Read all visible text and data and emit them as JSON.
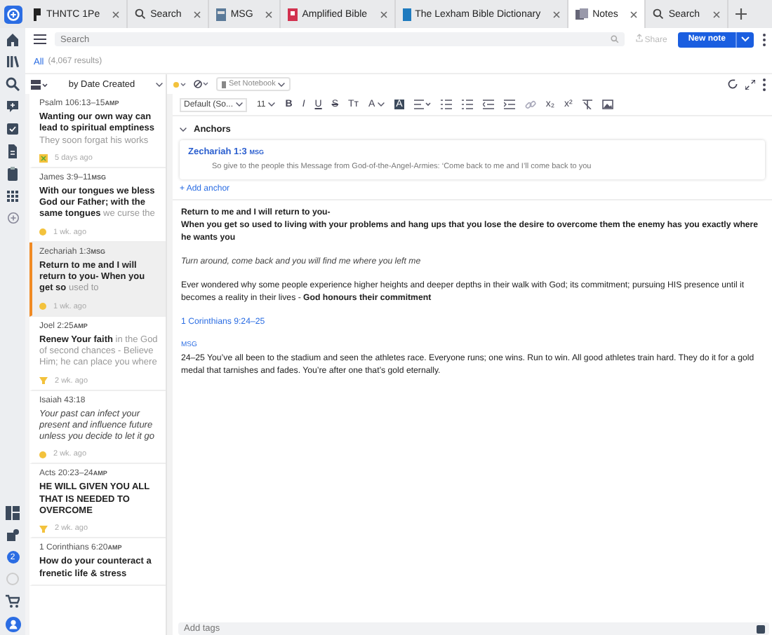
{
  "tabs": [
    {
      "label": "THNTC 1Pe",
      "kind": "book",
      "selected": false
    },
    {
      "label": "Search",
      "kind": "search",
      "selected": false
    },
    {
      "label": "MSG",
      "kind": "bible",
      "selected": false
    },
    {
      "label": "Amplified Bible",
      "kind": "redbook",
      "selected": false
    },
    {
      "label": "The Lexham Bible Dictionary",
      "kind": "bluebook",
      "selected": false
    },
    {
      "label": "Notes",
      "kind": "notes",
      "selected": true
    },
    {
      "label": "Search",
      "kind": "search",
      "selected": false
    }
  ],
  "header": {
    "search_placeholder": "Search",
    "share": {
      "label": "Share",
      "disabled": true
    },
    "new_note": "New note"
  },
  "filter": {
    "link": "All",
    "count": "(4,067 results)"
  },
  "list_controls": {
    "sort": "by Date Created",
    "notebook": "Set Notebook"
  },
  "notes": [
    {
      "reference": "Psalm 106:13–15",
      "version": "AMP",
      "body": "**Wanting our own way can lead to spiritual emptiness** They soon forgat his works",
      "italic": false,
      "kind": "box",
      "time": "5 days ago",
      "selected": false
    },
    {
      "reference": "James 3:9–11",
      "version": "MSG",
      "body": "**With our tongues we bless God our Father; with the same tongues** we curse the",
      "italic": false,
      "kind": "dot",
      "time": "1 wk. ago",
      "selected": false
    },
    {
      "reference": "Zechariah 1:3",
      "version": "MSG",
      "body": "**Return to me and I will return to you- When you get so** used to",
      "italic": false,
      "kind": "dot",
      "time": "1 wk. ago",
      "selected": true
    },
    {
      "reference": "Joel 2:25",
      "version": "AMP",
      "body": "**Renew Your faith** in the God of second chances - Believe Him; he can place you where",
      "italic": false,
      "kind": "highlighter",
      "time": "2 wk. ago",
      "selected": false
    },
    {
      "reference": "Isaiah 43:18",
      "body": "Your past can infect your present and influence future unless you decide to let it go",
      "italic": true,
      "kind": "dot",
      "time": "2 wk. ago",
      "selected": false
    },
    {
      "reference": "Acts 20:23–24",
      "version": "AMP",
      "body": "**HE WILL GIVEN YOU ALL THAT IS NEEDED TO OVERCOME**",
      "italic": false,
      "kind": "highlighter",
      "time": "2 wk. ago",
      "selected": false
    },
    {
      "reference": "1 Corinthians 6:20",
      "version": "AMP",
      "body": "**How do your counteract a frenetic life & stress**",
      "italic": false,
      "selected": false
    }
  ],
  "toolbar": {
    "font": "Default (So...",
    "size": "11",
    "buttons": [
      {
        "kind": "bold",
        "label": "B"
      },
      {
        "kind": "italic",
        "label": "I"
      },
      {
        "kind": "underline",
        "label": "U"
      },
      {
        "kind": "strike",
        "label": "S"
      },
      {
        "kind": "case",
        "label": "Tт"
      },
      {
        "kind": "color",
        "label": "A"
      },
      {
        "kind": "highlight",
        "label": "A"
      },
      {
        "kind": "align"
      },
      {
        "kind": "bullets"
      },
      {
        "kind": "numbers"
      },
      {
        "kind": "outdent"
      },
      {
        "kind": "indent"
      },
      {
        "kind": "link"
      },
      {
        "kind": "sub",
        "label": "x₂"
      },
      {
        "kind": "sup",
        "label": "x²"
      },
      {
        "kind": "clear"
      },
      {
        "kind": "image"
      }
    ]
  },
  "anchors": {
    "title": "Anchors",
    "items": [
      {
        "reference": "Zechariah 1:3",
        "version": "MSG",
        "text": "So give to the people this Message from God-of-the-Angel-Armies: ‘Come back to me and I’ll come back to you"
      }
    ],
    "add": "+ Add anchor"
  },
  "content": [
    {
      "kind": "bold",
      "lines": [
        "Return to me and I will return to you-",
        "When you get so used to living with your problems  and hang ups that you lose the desire to overcome them the enemy  has you exactly where he wants you"
      ]
    },
    {
      "kind": "italic",
      "lines": [
        "Turn around, come back and you will find me where you left me"
      ]
    },
    {
      "kind": "plain",
      "lines": [
        "Ever wondered  why some people experience  higher heights and deeper depths in their walk with God; its commitment; pursuing HIS presence  until it becomes a reality in their lives - **God honours their commitment**"
      ]
    },
    {
      "kind": "link",
      "lines": [
        "1 Corinthians 9:24–25"
      ]
    },
    {
      "kind": "version",
      "lines": [
        "MSG"
      ]
    },
    {
      "kind": "plain",
      "lines": [
        "24–25 You’ve all been to the stadium and seen the athletes race. Everyone runs; one wins. Run to win. All good athletes train hard. They do it for a gold medal that tarnishes and fades. You’re after one that’s gold eternally."
      ]
    }
  ],
  "tags_placeholder": "Add tags",
  "rail_badge": "2"
}
